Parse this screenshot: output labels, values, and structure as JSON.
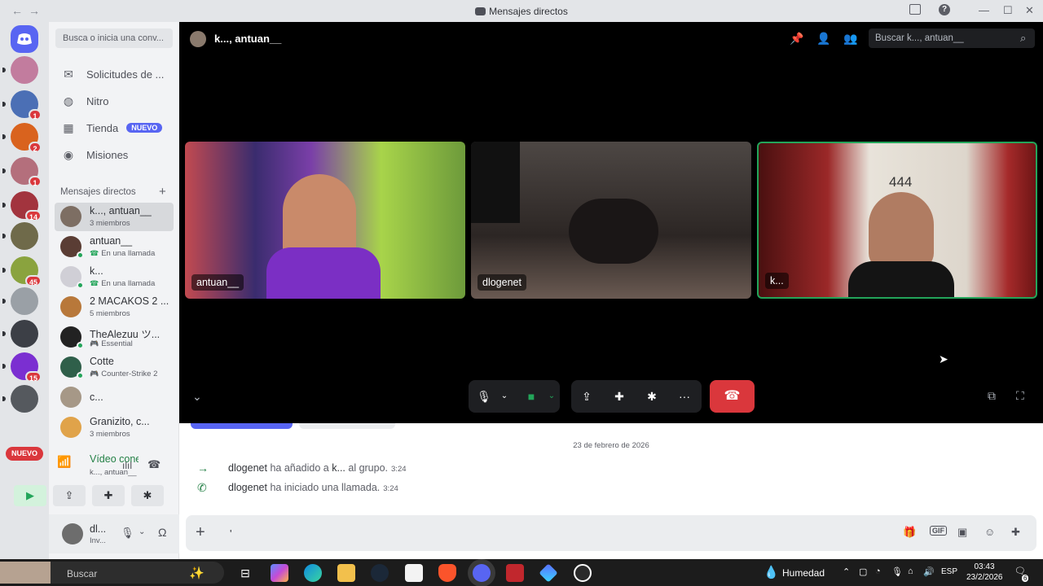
{
  "window": {
    "title": "Mensajes directos",
    "back_icon": "arrow-left",
    "forward_icon": "arrow-right"
  },
  "servers": [
    {
      "name": "discord-home",
      "color": "#5865f2"
    },
    {
      "name": "server-1",
      "color": "#c27c9e",
      "badge": ""
    },
    {
      "name": "server-2",
      "color": "#4b6fb5",
      "badge": "1"
    },
    {
      "name": "server-3",
      "color": "#d9631e",
      "badge": "2"
    },
    {
      "name": "server-4",
      "color": "#b46f7c",
      "badge": "1"
    },
    {
      "name": "server-5",
      "color": "#a2343e",
      "badge": "14"
    },
    {
      "name": "server-6",
      "color": "#6f6a4a",
      "badge": ""
    },
    {
      "name": "server-7",
      "color": "#8aa33e",
      "badge": "45"
    },
    {
      "name": "server-8",
      "color": "#9aa0a6",
      "badge": ""
    },
    {
      "name": "server-9",
      "color": "#3c3f46",
      "badge": ""
    },
    {
      "name": "server-10",
      "color": "#7b2fd1",
      "badge": "15"
    },
    {
      "name": "server-11",
      "color": "#55595e",
      "badge": ""
    }
  ],
  "server_new_label": "NUEVO",
  "sidebar": {
    "search_placeholder": "Busca o inicia una conv...",
    "nav": [
      {
        "label": "Solicitudes de ...",
        "icon": "mail-icon"
      },
      {
        "label": "Nitro",
        "icon": "nitro-icon"
      },
      {
        "label": "Tienda",
        "icon": "shop-icon",
        "tag": "NUEVO"
      },
      {
        "label": "Misiones",
        "icon": "quests-icon"
      }
    ],
    "dm_header": "Mensajes directos",
    "dms": [
      {
        "name": "k..., antuan__",
        "sub": "3 miembros",
        "active": true,
        "color": "#7d6e63"
      },
      {
        "name": "antuan__",
        "sub": "En una llamada",
        "color": "#5a3d34",
        "status": "call"
      },
      {
        "name": "k...",
        "sub": "En una llamada",
        "color": "#d0cfd6",
        "status": "call"
      },
      {
        "name": "2 MACAKOS 2 ...",
        "sub": "5 miembros",
        "color": "#b8783a"
      },
      {
        "name": "TheAlezuu ツ...",
        "sub": "Essential",
        "color": "#222222",
        "status": "game"
      },
      {
        "name": "Cotte",
        "sub": "Counter-Strike 2",
        "color": "#2f5f4a",
        "status": "game"
      },
      {
        "name": "c...",
        "sub": "",
        "color": "#a69887"
      },
      {
        "name": "Granizito, c...",
        "sub": "3 miembros",
        "color": "#e0a34a"
      }
    ]
  },
  "voice": {
    "status": "Vídeo conectado",
    "channel": "k..., antuan__"
  },
  "user": {
    "name": "dl...",
    "sub": "Inv..."
  },
  "call": {
    "title": "k..., antuan__",
    "search_placeholder": "Buscar k..., antuan__",
    "tiles": [
      {
        "label": "antuan__",
        "color": "#6a3f8f",
        "speaking": false
      },
      {
        "label": "dlogenet",
        "color": "#3a3432",
        "speaking": false
      },
      {
        "label": "k...",
        "color": "#5a2a24",
        "speaking": true
      }
    ]
  },
  "chat": {
    "date": "23 de febrero de 2026",
    "messages": [
      {
        "user": "dlogenet",
        "text": " ha añadido a ",
        "target": "k...",
        "text2": " al grupo.",
        "time": "3:24",
        "icon": "arrow-right-icon"
      },
      {
        "user": "dlogenet",
        "text": " ha iniciado una llamada.",
        "target": "",
        "text2": "",
        "time": "3:24",
        "icon": "phone-icon"
      }
    ],
    "composer_value": "'"
  },
  "taskbar": {
    "search_placeholder": "Buscar",
    "weather": "Humedad",
    "lang": "ESP",
    "time": "03:43",
    "date": "23/2/2026",
    "notifications": "6"
  }
}
